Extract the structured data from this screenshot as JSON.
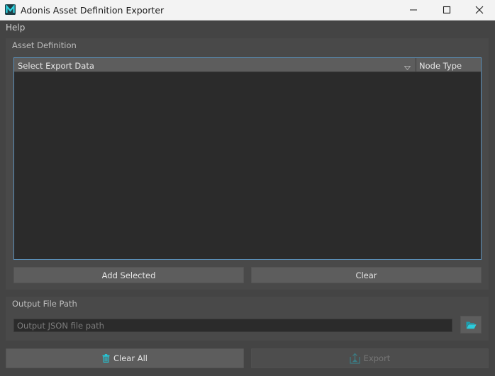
{
  "window": {
    "title": "Adonis Asset Definition Exporter",
    "app_icon_letter": "M"
  },
  "menu": {
    "items": [
      "Help"
    ]
  },
  "asset_definition": {
    "group_title": "Asset Definition",
    "columns": [
      "Select Export Data",
      "Node Type"
    ],
    "rows": [],
    "add_selected_label": "Add Selected",
    "clear_label": "Clear"
  },
  "output": {
    "group_title": "Output File Path",
    "path_value": "",
    "path_placeholder": "Output JSON file path",
    "browse_icon": "folder-open-icon"
  },
  "actions": {
    "clear_all_label": "Clear All",
    "clear_all_icon": "trash-icon",
    "export_label": "Export",
    "export_icon": "export-icon",
    "export_enabled": false
  },
  "colors": {
    "accent": "#22b7c9",
    "selection_border": "#5b90b8",
    "background": "#444444"
  }
}
